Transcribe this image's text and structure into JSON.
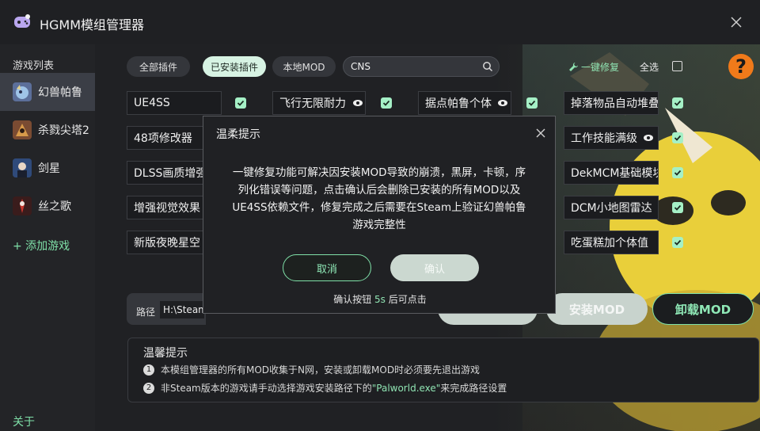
{
  "app": {
    "title": "HGMM模组管理器"
  },
  "sidebar": {
    "heading": "游戏列表",
    "items": [
      {
        "label": "幻兽帕鲁",
        "active": true,
        "icon": "palworld-icon"
      },
      {
        "label": "杀戮尖塔2",
        "active": false,
        "icon": "slay-the-spire-icon"
      },
      {
        "label": "剑星",
        "active": false,
        "icon": "stellar-blade-icon"
      },
      {
        "label": "丝之歌",
        "active": false,
        "icon": "silksong-icon"
      }
    ],
    "add_game": "+ 添加游戏",
    "about": "关于"
  },
  "filters": {
    "all": "全部插件",
    "installed": "已安装插件",
    "local": "本地MOD"
  },
  "search": {
    "value": "CNS",
    "placeholder": ""
  },
  "actions": {
    "one_click_repair": "一键修复",
    "select_all": "全选",
    "help": "?"
  },
  "plugins": [
    {
      "name": "UE4SS",
      "eye": false,
      "checked": true
    },
    {
      "name": "飞行无限耐力",
      "eye": true,
      "checked": true
    },
    {
      "name": "据点帕鲁个体",
      "eye": true,
      "checked": true
    },
    {
      "name": "掉落物品自动堆叠",
      "eye": false,
      "checked": true
    },
    {
      "name": "48项修改器",
      "eye": false,
      "checked": false
    },
    {
      "name": "工作技能满级",
      "eye": true,
      "checked": true
    },
    {
      "name": "DLSS画质增强",
      "eye": false,
      "checked": false
    },
    {
      "name": "DekMCM基础模块",
      "eye": false,
      "checked": true
    },
    {
      "name": "增强视觉效果",
      "eye": false,
      "checked": false
    },
    {
      "name": "DCM小地图雷达",
      "eye": false,
      "checked": true
    },
    {
      "name": "新版夜晚星空",
      "eye": false,
      "checked": false
    },
    {
      "name": "吃蛋糕加个体值",
      "eye": false,
      "checked": true
    }
  ],
  "path": {
    "label": "路径",
    "value": "H:\\Steam"
  },
  "buttons": {
    "install": "安装MOD",
    "uninstall": "卸载MOD"
  },
  "tips": {
    "title": "温馨提示",
    "items": [
      {
        "num": "1",
        "text": "本模组管理器的所有MOD收集于N网，安装或卸载MOD时必须要先退出游戏"
      },
      {
        "num": "2",
        "pre": "非Steam版本的游戏请手动选择游戏安装路径下的",
        "highlight": "\"Palworld.exe\"",
        "post": "来完成路径设置"
      }
    ]
  },
  "modal": {
    "title": "温柔提示",
    "body": "一键修复功能可解决因安装MOD导致的崩溃，黑屏，卡顿，序列化错误等问题，点击确认后会删除已安装的所有MOD以及UE4SS依赖文件，修复完成之后需要在Steam上验证幻兽帕鲁游戏完整性",
    "cancel": "取消",
    "confirm": "确认",
    "countdown_pre": "确认按钮 ",
    "countdown_sec": "5s",
    "countdown_post": " 后可点击"
  },
  "colors": {
    "accent": "#7fe0a8",
    "check": "#a5f0c6",
    "help": "#f07a1a",
    "active_sidebar": "#3b3e46"
  }
}
